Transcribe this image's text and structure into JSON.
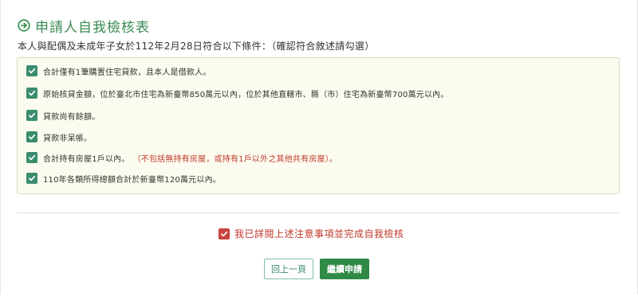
{
  "header": {
    "title": "申請人自我檢核表",
    "subtitle": "本人與配偶及未成年子女於112年2月28日符合以下條件：（確認符合敘述請勾選）"
  },
  "checklist": [
    {
      "text": "合計僅有1筆購置住宅貸款，且本人是借款人。",
      "note": "",
      "checked": true
    },
    {
      "text": "原始核貸金額，位於臺北市住宅為新臺幣850萬元以內，位於其他直轄市、縣（市）住宅為新臺幣700萬元以內。",
      "note": "",
      "checked": true
    },
    {
      "text": "貸款尚有餘額。",
      "note": "",
      "checked": true
    },
    {
      "text": "貸款非呆帳。",
      "note": "",
      "checked": true
    },
    {
      "text": "合計持有房屋1戶以內。",
      "note": "（不包括無持有房屋，或持有1戶以外之其他共有房屋）。",
      "checked": true
    },
    {
      "text": "110年各類所得總額合計於新臺幣120萬元以內。",
      "note": "",
      "checked": true
    }
  ],
  "confirm": {
    "text": "我已詳閱上述注意事項並完成自我檢核",
    "checked": true
  },
  "buttons": {
    "back": "回上一頁",
    "next": "繼續申請"
  },
  "colors": {
    "accent_green": "#3a8a52",
    "checkbox_green": "#3b8d6d",
    "button_green": "#2e8a45",
    "note_red": "#c0392b",
    "panel_bg": "#fbfcef"
  }
}
